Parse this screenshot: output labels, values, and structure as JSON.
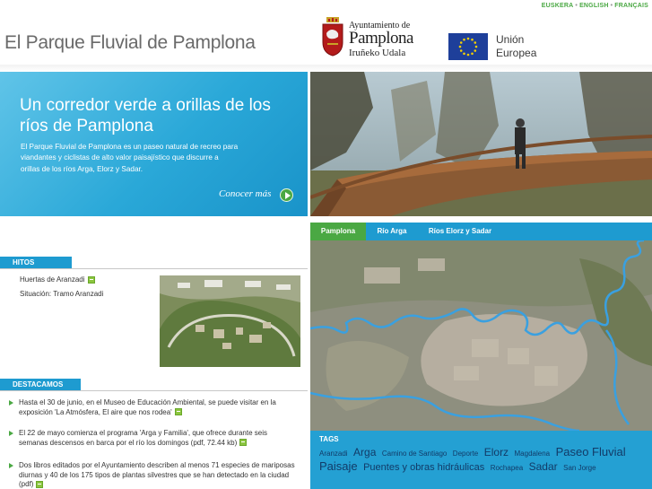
{
  "languages": [
    "EUSKERA",
    "ENGLISH",
    "FRANÇAIS"
  ],
  "header": {
    "site_title": "El Parque Fluvial de Pamplona",
    "ayuntamiento_line1": "Ayuntamiento de",
    "ayuntamiento_line2": "Pamplona",
    "ayuntamiento_line3": "Iruñeko Udala",
    "eu_line1": "Unión",
    "eu_line2": "Europea"
  },
  "hero": {
    "heading": "Un corredor verde a orillas de los ríos de Pamplona",
    "text_line1": "El Parque Fluvial de Pamplona es un paseo natural de recreo para viandantes y ciclistas de alto valor paisajístico que discurre a",
    "text_line2": "orillas de los ríos Arga, Elorz y Sadar.",
    "more_label": "Conocer más"
  },
  "hitos": {
    "title": "HITOS",
    "link": "Huertas de Aranzadi",
    "situation": "Situación: Tramo Aranzadi"
  },
  "destacamos": {
    "title": "DESTACAMOS",
    "items": [
      "Hasta el 30 de junio, en el Museo de Educación Ambiental, se puede visitar en la exposición 'La Atmósfera, El aire que nos rodea'",
      "El 22 de mayo comienza el programa 'Arga y Familia', que ofrece durante seis semanas descensos en barca por el río los domingos (pdf, 72.44 kb)",
      "Dos libros editados por el Ayuntamiento describen al menos 71 especies de mariposas diurnas y 40 de los 175 tipos de plantas silvestres que se han detectado en la ciudad (pdf)"
    ]
  },
  "map_tabs": [
    "Pamplona",
    "Río Arga",
    "Ríos Elorz y Sadar"
  ],
  "tags": {
    "title": "TAGS",
    "items": [
      {
        "label": "Aranzadi",
        "size": 8
      },
      {
        "label": "Arga",
        "size": 12
      },
      {
        "label": "Camino de Santiago",
        "size": 8
      },
      {
        "label": "Deporte",
        "size": 8
      },
      {
        "label": "Elorz",
        "size": 12
      },
      {
        "label": "Magdalena",
        "size": 8
      },
      {
        "label": "Paseo Fluvial",
        "size": 13
      },
      {
        "label": "Paisaje",
        "size": 13
      },
      {
        "label": "Puentes y obras hidráulicas",
        "size": 11
      },
      {
        "label": "Rochapea",
        "size": 8
      },
      {
        "label": "Sadar",
        "size": 12
      },
      {
        "label": "San Jorge",
        "size": 8
      }
    ]
  },
  "colors": {
    "accent_blue": "#1e9bd0",
    "accent_green": "#4aa843"
  }
}
